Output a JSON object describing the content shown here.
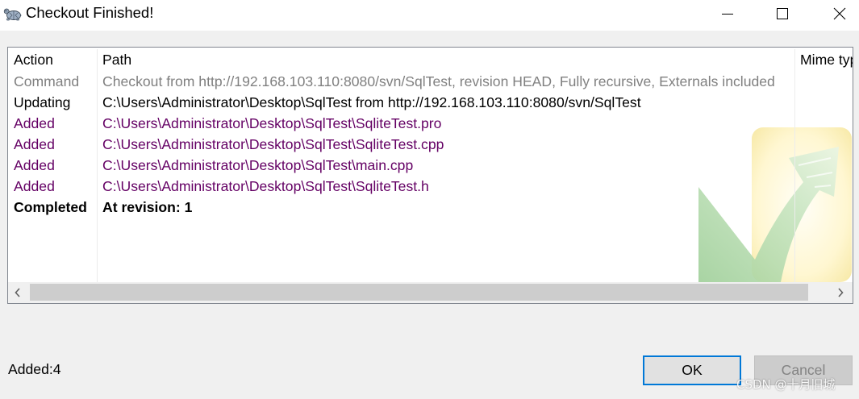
{
  "window": {
    "title": "Checkout Finished!",
    "icons": {
      "app": "turtle-icon",
      "minimize": "minimize-icon",
      "maximize": "maximize-icon",
      "close": "close-icon"
    }
  },
  "list": {
    "columns": [
      "Action",
      "Path",
      "Mime type"
    ],
    "rows": [
      {
        "action": "Command",
        "path": "Checkout from http://192.168.103.110:8080/svn/SqlTest, revision HEAD, Fully recursive, Externals included",
        "color": "#808080",
        "bold": false
      },
      {
        "action": "Updating",
        "path": "C:\\Users\\Administrator\\Desktop\\SqlTest from http://192.168.103.110:8080/svn/SqlTest",
        "color": "#000000",
        "bold": false
      },
      {
        "action": "Added",
        "path": "C:\\Users\\Administrator\\Desktop\\SqlTest\\SqliteTest.pro",
        "color": "#640064",
        "bold": false
      },
      {
        "action": "Added",
        "path": "C:\\Users\\Administrator\\Desktop\\SqlTest\\SqliteTest.cpp",
        "color": "#640064",
        "bold": false
      },
      {
        "action": "Added",
        "path": "C:\\Users\\Administrator\\Desktop\\SqlTest\\main.cpp",
        "color": "#640064",
        "bold": false
      },
      {
        "action": "Added",
        "path": "C:\\Users\\Administrator\\Desktop\\SqlTest\\SqliteTest.h",
        "color": "#640064",
        "bold": false
      },
      {
        "action": "Completed",
        "path": "At revision: 1",
        "color": "#000000",
        "bold": true
      }
    ],
    "watermark_icon": "tortoisesvn-checkmark-icon",
    "scrollbar_icons": {
      "left": "chevron-left-icon",
      "right": "chevron-right-icon"
    }
  },
  "status": {
    "text": "Added:4"
  },
  "buttons": {
    "ok": "OK",
    "cancel": "Cancel",
    "cancel_enabled": false
  },
  "colors": {
    "accent": "#0078d7",
    "titlebar": "#ffffff",
    "dialog": "#f0f0f0"
  },
  "overlay_watermark": "CSDN @十月旧城"
}
